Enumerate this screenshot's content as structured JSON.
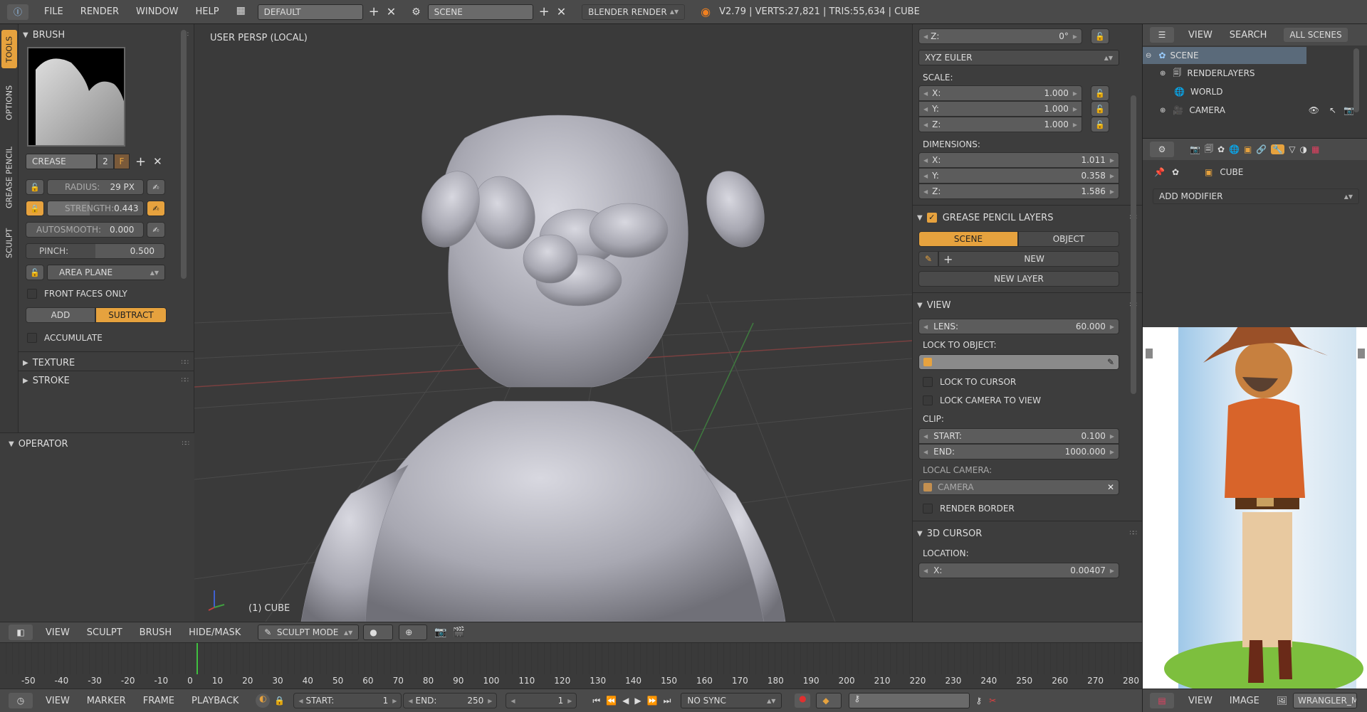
{
  "topbar": {
    "menus": [
      "FILE",
      "RENDER",
      "WINDOW",
      "HELP"
    ],
    "layout": "DEFAULT",
    "scene": "SCENE",
    "engine": "BLENDER RENDER",
    "stats": "V2.79 | VERTS:27,821 | TRIS:55,634 | CUBE"
  },
  "vtabs": [
    "TOOLS",
    "OPTIONS",
    "GREASE PENCIL",
    "SCULPT"
  ],
  "brush": {
    "header": "BRUSH",
    "name": "CREASE",
    "users": "2",
    "fake_user": "F",
    "radius_label": "RADIUS:",
    "radius_value": "29 PX",
    "strength_label": "STRENGTH:",
    "strength_value": "0.443",
    "strength_fraction": 0.443,
    "autosmooth_label": "AUTOSMOOTH:",
    "autosmooth_value": "0.000",
    "pinch_label": "PINCH:",
    "pinch_value": "0.500",
    "pinch_fraction": 0.5,
    "area_plane": "AREA PLANE",
    "front_faces": "FRONT FACES ONLY",
    "add": "ADD",
    "subtract": "SUBTRACT",
    "accumulate": "ACCUMULATE",
    "texture": "TEXTURE",
    "stroke": "STROKE"
  },
  "operator": "OPERATOR",
  "viewport": {
    "persp": "USER PERSP (LOCAL)",
    "object": "(1) CUBE"
  },
  "npanel": {
    "rot_z_label": "Z:",
    "rot_z_value": "0°",
    "euler": "XYZ EULER",
    "scale_label": "SCALE:",
    "scale": [
      {
        "axis": "X:",
        "v": "1.000"
      },
      {
        "axis": "Y:",
        "v": "1.000"
      },
      {
        "axis": "Z:",
        "v": "1.000"
      }
    ],
    "dims_label": "DIMENSIONS:",
    "dims": [
      {
        "axis": "X:",
        "v": "1.011"
      },
      {
        "axis": "Y:",
        "v": "0.358"
      },
      {
        "axis": "Z:",
        "v": "1.586"
      }
    ],
    "gp_layers": "GREASE PENCIL LAYERS",
    "gp_scene": "SCENE",
    "gp_object": "OBJECT",
    "gp_new": "NEW",
    "gp_new_layer": "NEW LAYER",
    "view": "VIEW",
    "lens_label": "LENS:",
    "lens_value": "60.000",
    "lock_obj": "LOCK TO OBJECT:",
    "lock_cursor": "LOCK TO CURSOR",
    "lock_cam": "LOCK CAMERA TO VIEW",
    "clip": "CLIP:",
    "clip_start_label": "START:",
    "clip_start": "0.100",
    "clip_end_label": "END:",
    "clip_end": "1000.000",
    "local_cam": "LOCAL CAMERA:",
    "camera": "CAMERA",
    "render_border": "RENDER BORDER",
    "cursor3d": "3D CURSOR",
    "location": "LOCATION:",
    "loc_x_label": "X:",
    "loc_x": "0.00407"
  },
  "viewport_header": {
    "items": [
      "VIEW",
      "SCULPT",
      "BRUSH",
      "HIDE/MASK"
    ],
    "mode": "SCULPT MODE"
  },
  "timeline": {
    "ticks": [
      "-50",
      "-40",
      "-30",
      "-20",
      "-10",
      "0",
      "10",
      "20",
      "30",
      "40",
      "50",
      "60",
      "70",
      "80",
      "90",
      "100",
      "110",
      "120",
      "130",
      "140",
      "150",
      "160",
      "170",
      "180",
      "190",
      "200",
      "210",
      "220",
      "230",
      "240",
      "250",
      "260",
      "270",
      "280"
    ],
    "menus": [
      "VIEW",
      "MARKER",
      "FRAME",
      "PLAYBACK"
    ],
    "start_label": "START:",
    "start": "1",
    "end_label": "END:",
    "end": "250",
    "current": "1",
    "sync": "NO SYNC"
  },
  "outliner": {
    "tabs": [
      "VIEW",
      "SEARCH",
      "ALL SCENES"
    ],
    "items": [
      {
        "label": "SCENE"
      },
      {
        "label": "RENDERLAYERS"
      },
      {
        "label": "WORLD"
      },
      {
        "label": "CAMERA"
      }
    ]
  },
  "properties": {
    "object": "CUBE",
    "add_modifier": "ADD MODIFIER"
  },
  "image_editor": {
    "menus": [
      "VIEW",
      "IMAGE"
    ],
    "image_name": "WRANGLER_MC"
  },
  "colors": {
    "accent": "#e6a23e",
    "bg": "#3d3d3d",
    "viewport": "#3a3a3a"
  }
}
